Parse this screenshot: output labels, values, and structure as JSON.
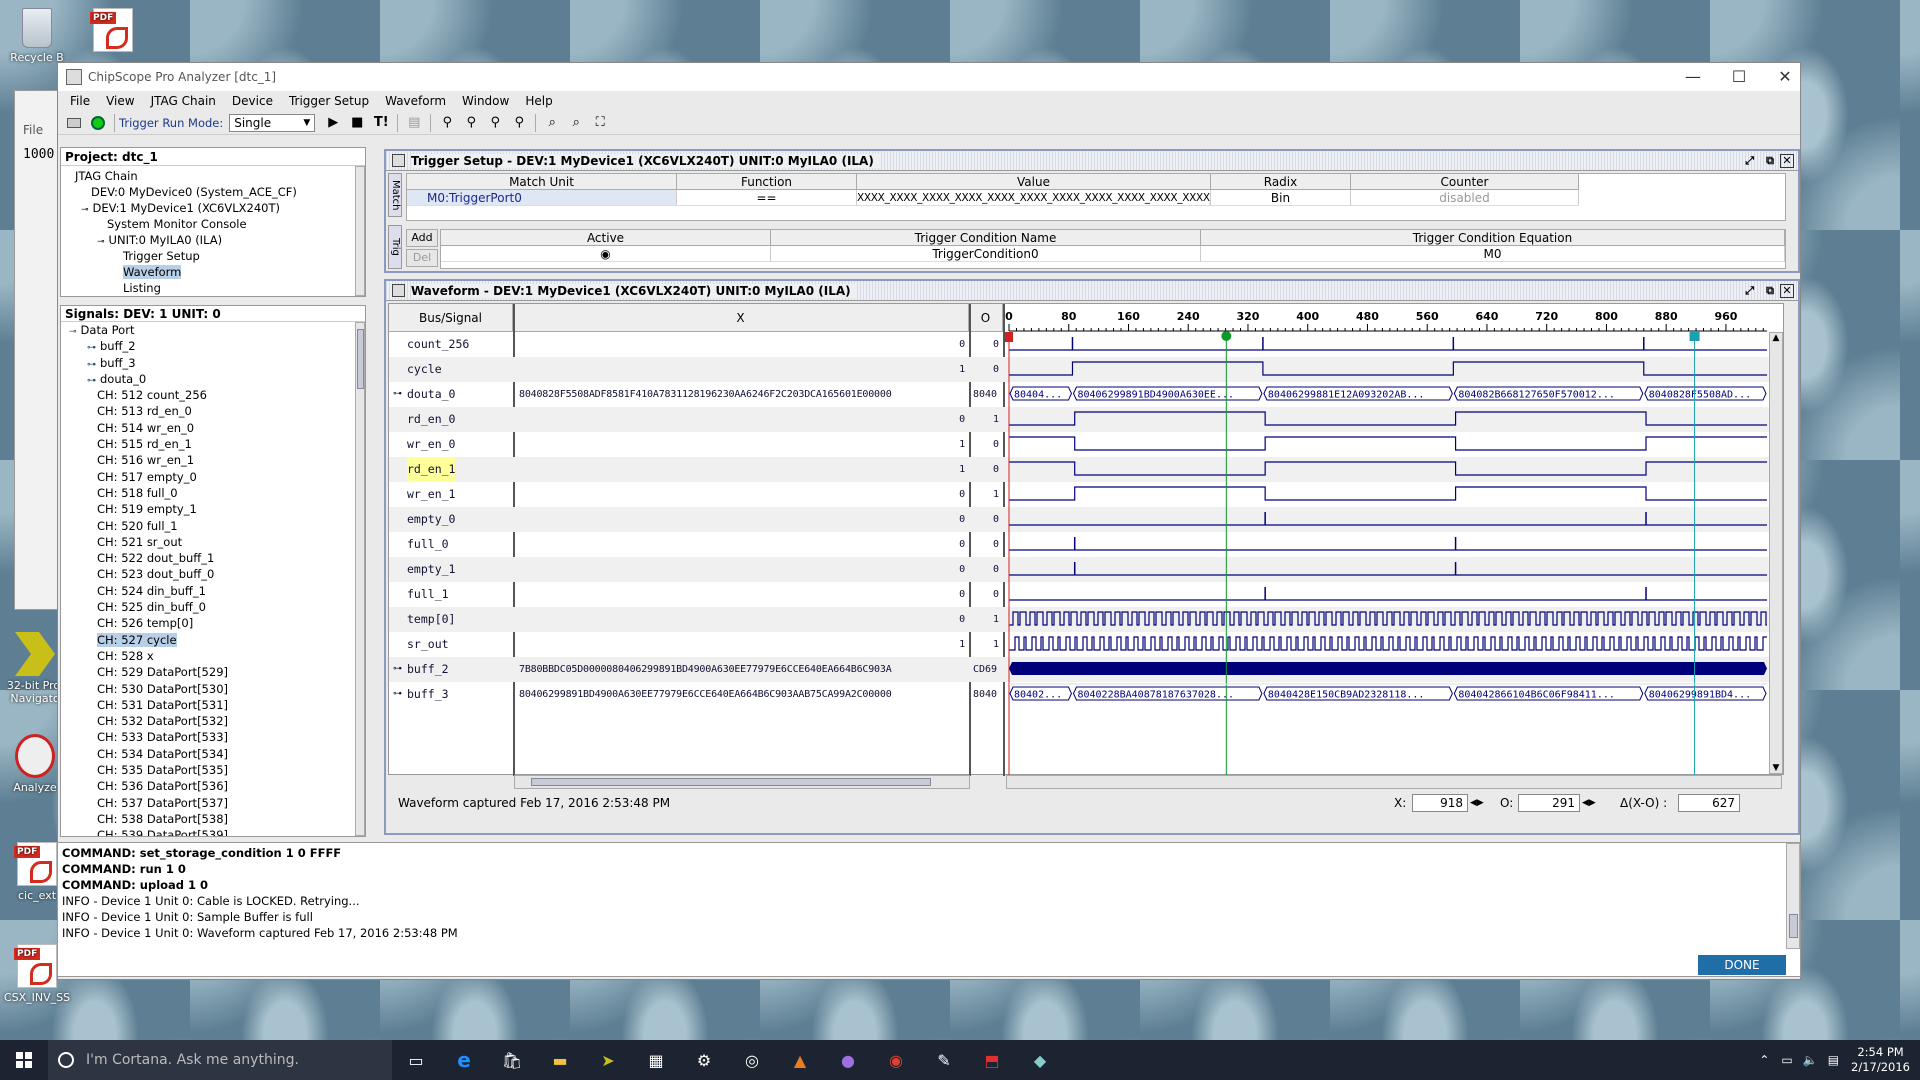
{
  "desktop": {
    "icons": [
      {
        "id": "recycle",
        "label": "Recycle B"
      },
      {
        "id": "pdf1",
        "label": ""
      },
      {
        "id": "nav",
        "label": "32-bit Proj Navigato"
      },
      {
        "id": "analyzer",
        "label": "Analyze"
      },
      {
        "id": "cic",
        "label": "cic_ext"
      },
      {
        "id": "csx",
        "label": "CSX_INV_SS"
      }
    ],
    "behind_window": {
      "file_menu": "File",
      "value": "1000"
    }
  },
  "window": {
    "title": "ChipScope Pro Analyzer [dtc_1]",
    "controls": {
      "minimize": "—",
      "maximize": "☐",
      "close": "✕"
    },
    "menu": [
      "File",
      "View",
      "JTAG Chain",
      "Device",
      "Trigger Setup",
      "Waveform",
      "Window",
      "Help"
    ],
    "toolbar": {
      "trigger_run_mode_label": "Trigger Run Mode:",
      "trigger_run_mode_value": "Single",
      "t_excl": "T!"
    }
  },
  "project": {
    "header": "Project: dtc_1",
    "tree": [
      {
        "label": "JTAG Chain",
        "indent": 0
      },
      {
        "label": "DEV:0 MyDevice0 (System_ACE_CF)",
        "indent": 1
      },
      {
        "label": "DEV:1 MyDevice1 (XC6VLX240T)",
        "indent": 1,
        "toggle": "⊸"
      },
      {
        "label": "System Monitor Console",
        "indent": 2
      },
      {
        "label": "UNIT:0 MyILA0 (ILA)",
        "indent": 2,
        "toggle": "⊸"
      },
      {
        "label": "Trigger Setup",
        "indent": 3
      },
      {
        "label": "Waveform",
        "indent": 3,
        "selected": true
      },
      {
        "label": "Listing",
        "indent": 3
      }
    ]
  },
  "signals_panel": {
    "header": "Signals: DEV: 1 UNIT: 0",
    "items": [
      {
        "label": "Data Port",
        "indent": 0,
        "toggle": "⊸"
      },
      {
        "label": "buff_2",
        "indent": 1,
        "toggle": "⊶"
      },
      {
        "label": "buff_3",
        "indent": 1,
        "toggle": "⊶"
      },
      {
        "label": "douta_0",
        "indent": 1,
        "toggle": "⊶"
      },
      {
        "label": "CH: 512 count_256",
        "indent": 1
      },
      {
        "label": "CH: 513 rd_en_0",
        "indent": 1
      },
      {
        "label": "CH: 514 wr_en_0",
        "indent": 1
      },
      {
        "label": "CH: 515 rd_en_1",
        "indent": 1
      },
      {
        "label": "CH: 516 wr_en_1",
        "indent": 1
      },
      {
        "label": "CH: 517 empty_0",
        "indent": 1
      },
      {
        "label": "CH: 518 full_0",
        "indent": 1
      },
      {
        "label": "CH: 519 empty_1",
        "indent": 1
      },
      {
        "label": "CH: 520 full_1",
        "indent": 1
      },
      {
        "label": "CH: 521 sr_out",
        "indent": 1
      },
      {
        "label": "CH: 522 dout_buff_1",
        "indent": 1
      },
      {
        "label": "CH: 523 dout_buff_0",
        "indent": 1
      },
      {
        "label": "CH: 524 din_buff_1",
        "indent": 1
      },
      {
        "label": "CH: 525 din_buff_0",
        "indent": 1
      },
      {
        "label": "CH: 526 temp[0]",
        "indent": 1
      },
      {
        "label": "CH: 527 cycle",
        "indent": 1,
        "selected": true
      },
      {
        "label": "CH: 528 x",
        "indent": 1
      },
      {
        "label": "CH: 529 DataPort[529]",
        "indent": 1
      },
      {
        "label": "CH: 530 DataPort[530]",
        "indent": 1
      },
      {
        "label": "CH: 531 DataPort[531]",
        "indent": 1
      },
      {
        "label": "CH: 532 DataPort[532]",
        "indent": 1
      },
      {
        "label": "CH: 533 DataPort[533]",
        "indent": 1
      },
      {
        "label": "CH: 534 DataPort[534]",
        "indent": 1
      },
      {
        "label": "CH: 535 DataPort[535]",
        "indent": 1
      },
      {
        "label": "CH: 536 DataPort[536]",
        "indent": 1
      },
      {
        "label": "CH: 537 DataPort[537]",
        "indent": 1
      },
      {
        "label": "CH: 538 DataPort[538]",
        "indent": 1
      },
      {
        "label": "CH: 539 DataPort[539]",
        "indent": 1
      }
    ]
  },
  "trigger_setup": {
    "title": "Trigger Setup - DEV:1 MyDevice1 (XC6VLX240T) UNIT:0 MyILA0 (ILA)",
    "match_tab": "Match",
    "trig_tab": "Trig",
    "match_headers": [
      "Match Unit",
      "Function",
      "Value",
      "Radix",
      "Counter"
    ],
    "match_row": [
      "M0:TriggerPort0",
      "==",
      "XXXX_XXXX_XXXX_XXXX_XXXX_XXXX_XXXX_XXXX_XXXX_XXXX_XXXX_XXXX_X",
      "Bin",
      "disabled"
    ],
    "add_label": "Add",
    "del_label": "Del",
    "trig_headers": [
      "Active",
      "Trigger Condition Name",
      "Trigger Condition Equation"
    ],
    "trig_row": [
      "◉",
      "TriggerCondition0",
      "M0"
    ]
  },
  "waveform": {
    "title": "Waveform - DEV:1 MyDevice1 (XC6VLX240T) UNIT:0 MyILA0 (ILA)",
    "col_bus": "Bus/Signal",
    "col_x": "X",
    "col_o": "O",
    "timeline_ticks": [
      "0",
      "80",
      "160",
      "240",
      "320",
      "400",
      "480",
      "560",
      "640",
      "720",
      "800",
      "880",
      "960"
    ],
    "markers": {
      "trigger": "T",
      "o_marker": "O",
      "x_marker": "X"
    },
    "signals": [
      {
        "name": "count_256",
        "x": "0",
        "o": "0",
        "type": "pulse",
        "highlight": false
      },
      {
        "name": "cycle",
        "x": "1",
        "o": "0",
        "type": "cycle",
        "highlight": false
      },
      {
        "name": "douta_0",
        "bus": true,
        "x": "8040828F5508ADF8581F410A7831128196230AA6246F2C203DCA165601E00000",
        "o": "8040",
        "type": "bus",
        "segments": [
          "80404...",
          "80406299891BD4900A630EE...",
          "80406299881E12A093202AB...",
          "804082B668127650F570012...",
          "8040828F5508AD..."
        ],
        "highlight": false
      },
      {
        "name": "rd_en_0",
        "x": "0",
        "o": "1",
        "type": "rd",
        "highlight": false
      },
      {
        "name": "wr_en_0",
        "x": "1",
        "o": "0",
        "type": "wr",
        "highlight": false
      },
      {
        "name": "rd_en_1",
        "x": "1",
        "o": "0",
        "type": "wr",
        "highlight": true
      },
      {
        "name": "wr_en_1",
        "x": "0",
        "o": "1",
        "type": "rd",
        "highlight": false
      },
      {
        "name": "empty_0",
        "x": "0",
        "o": "0",
        "type": "empty0",
        "highlight": false
      },
      {
        "name": "full_0",
        "x": "0",
        "o": "0",
        "type": "full0",
        "highlight": false
      },
      {
        "name": "empty_1",
        "x": "0",
        "o": "0",
        "type": "full0",
        "highlight": false
      },
      {
        "name": "full_1",
        "x": "0",
        "o": "0",
        "type": "empty0",
        "highlight": false
      },
      {
        "name": "temp[0]",
        "x": "0",
        "o": "1",
        "type": "dense",
        "highlight": false
      },
      {
        "name": "sr_out",
        "x": "1",
        "o": "1",
        "type": "dense",
        "highlight": false
      },
      {
        "name": "buff_2",
        "bus": true,
        "x": "7B80BBDC05D0000080406299891BD4900A630EE77979E6CCE640EA664B6C903A",
        "o": "CD69",
        "type": "solid",
        "highlight": false
      },
      {
        "name": "buff_3",
        "bus": true,
        "x": "80406299891BD4900A630EE77979E6CCE640EA664B6C903AAB75CA99A2C00000",
        "o": "8040",
        "type": "bus",
        "segments": [
          "80402...",
          "8040228BA40878187637028...",
          "8040428E150CB9AD2328118...",
          "804042866104B6C06F98411...",
          "80406299891BD4..."
        ],
        "highlight": false
      }
    ],
    "status": "Waveform captured Feb 17, 2016 2:53:48 PM",
    "x_label": "X:",
    "x_value": "918",
    "o_label": "O:",
    "o_value": "291",
    "delta_label": "Δ(X-O) :",
    "delta_value": "627"
  },
  "console": {
    "lines": [
      {
        "text": "COMMAND: set_storage_condition 1 0 FFFF",
        "bold": true
      },
      {
        "text": "COMMAND: run 1 0",
        "bold": true
      },
      {
        "text": "COMMAND: upload 1 0",
        "bold": true
      },
      {
        "text": "INFO - Device 1 Unit 0:  Cable is LOCKED. Retrying...",
        "bold": false
      },
      {
        "text": "INFO - Device 1 Unit 0:  Sample Buffer is full",
        "bold": false
      },
      {
        "text": "INFO - Device 1 Unit 0: Waveform captured Feb 17, 2016 2:53:48 PM",
        "bold": false
      }
    ],
    "done_label": "DONE"
  },
  "taskbar": {
    "search_placeholder": "I'm Cortana. Ask me anything.",
    "time": "2:54 PM",
    "date": "2/17/2016"
  },
  "colors": {
    "wave": "#00007a",
    "green_cursor": "#0a9a2a",
    "teal_cursor": "#1aa0b0",
    "trigger": "#d02020",
    "accent_done": "#1f6ea8"
  }
}
